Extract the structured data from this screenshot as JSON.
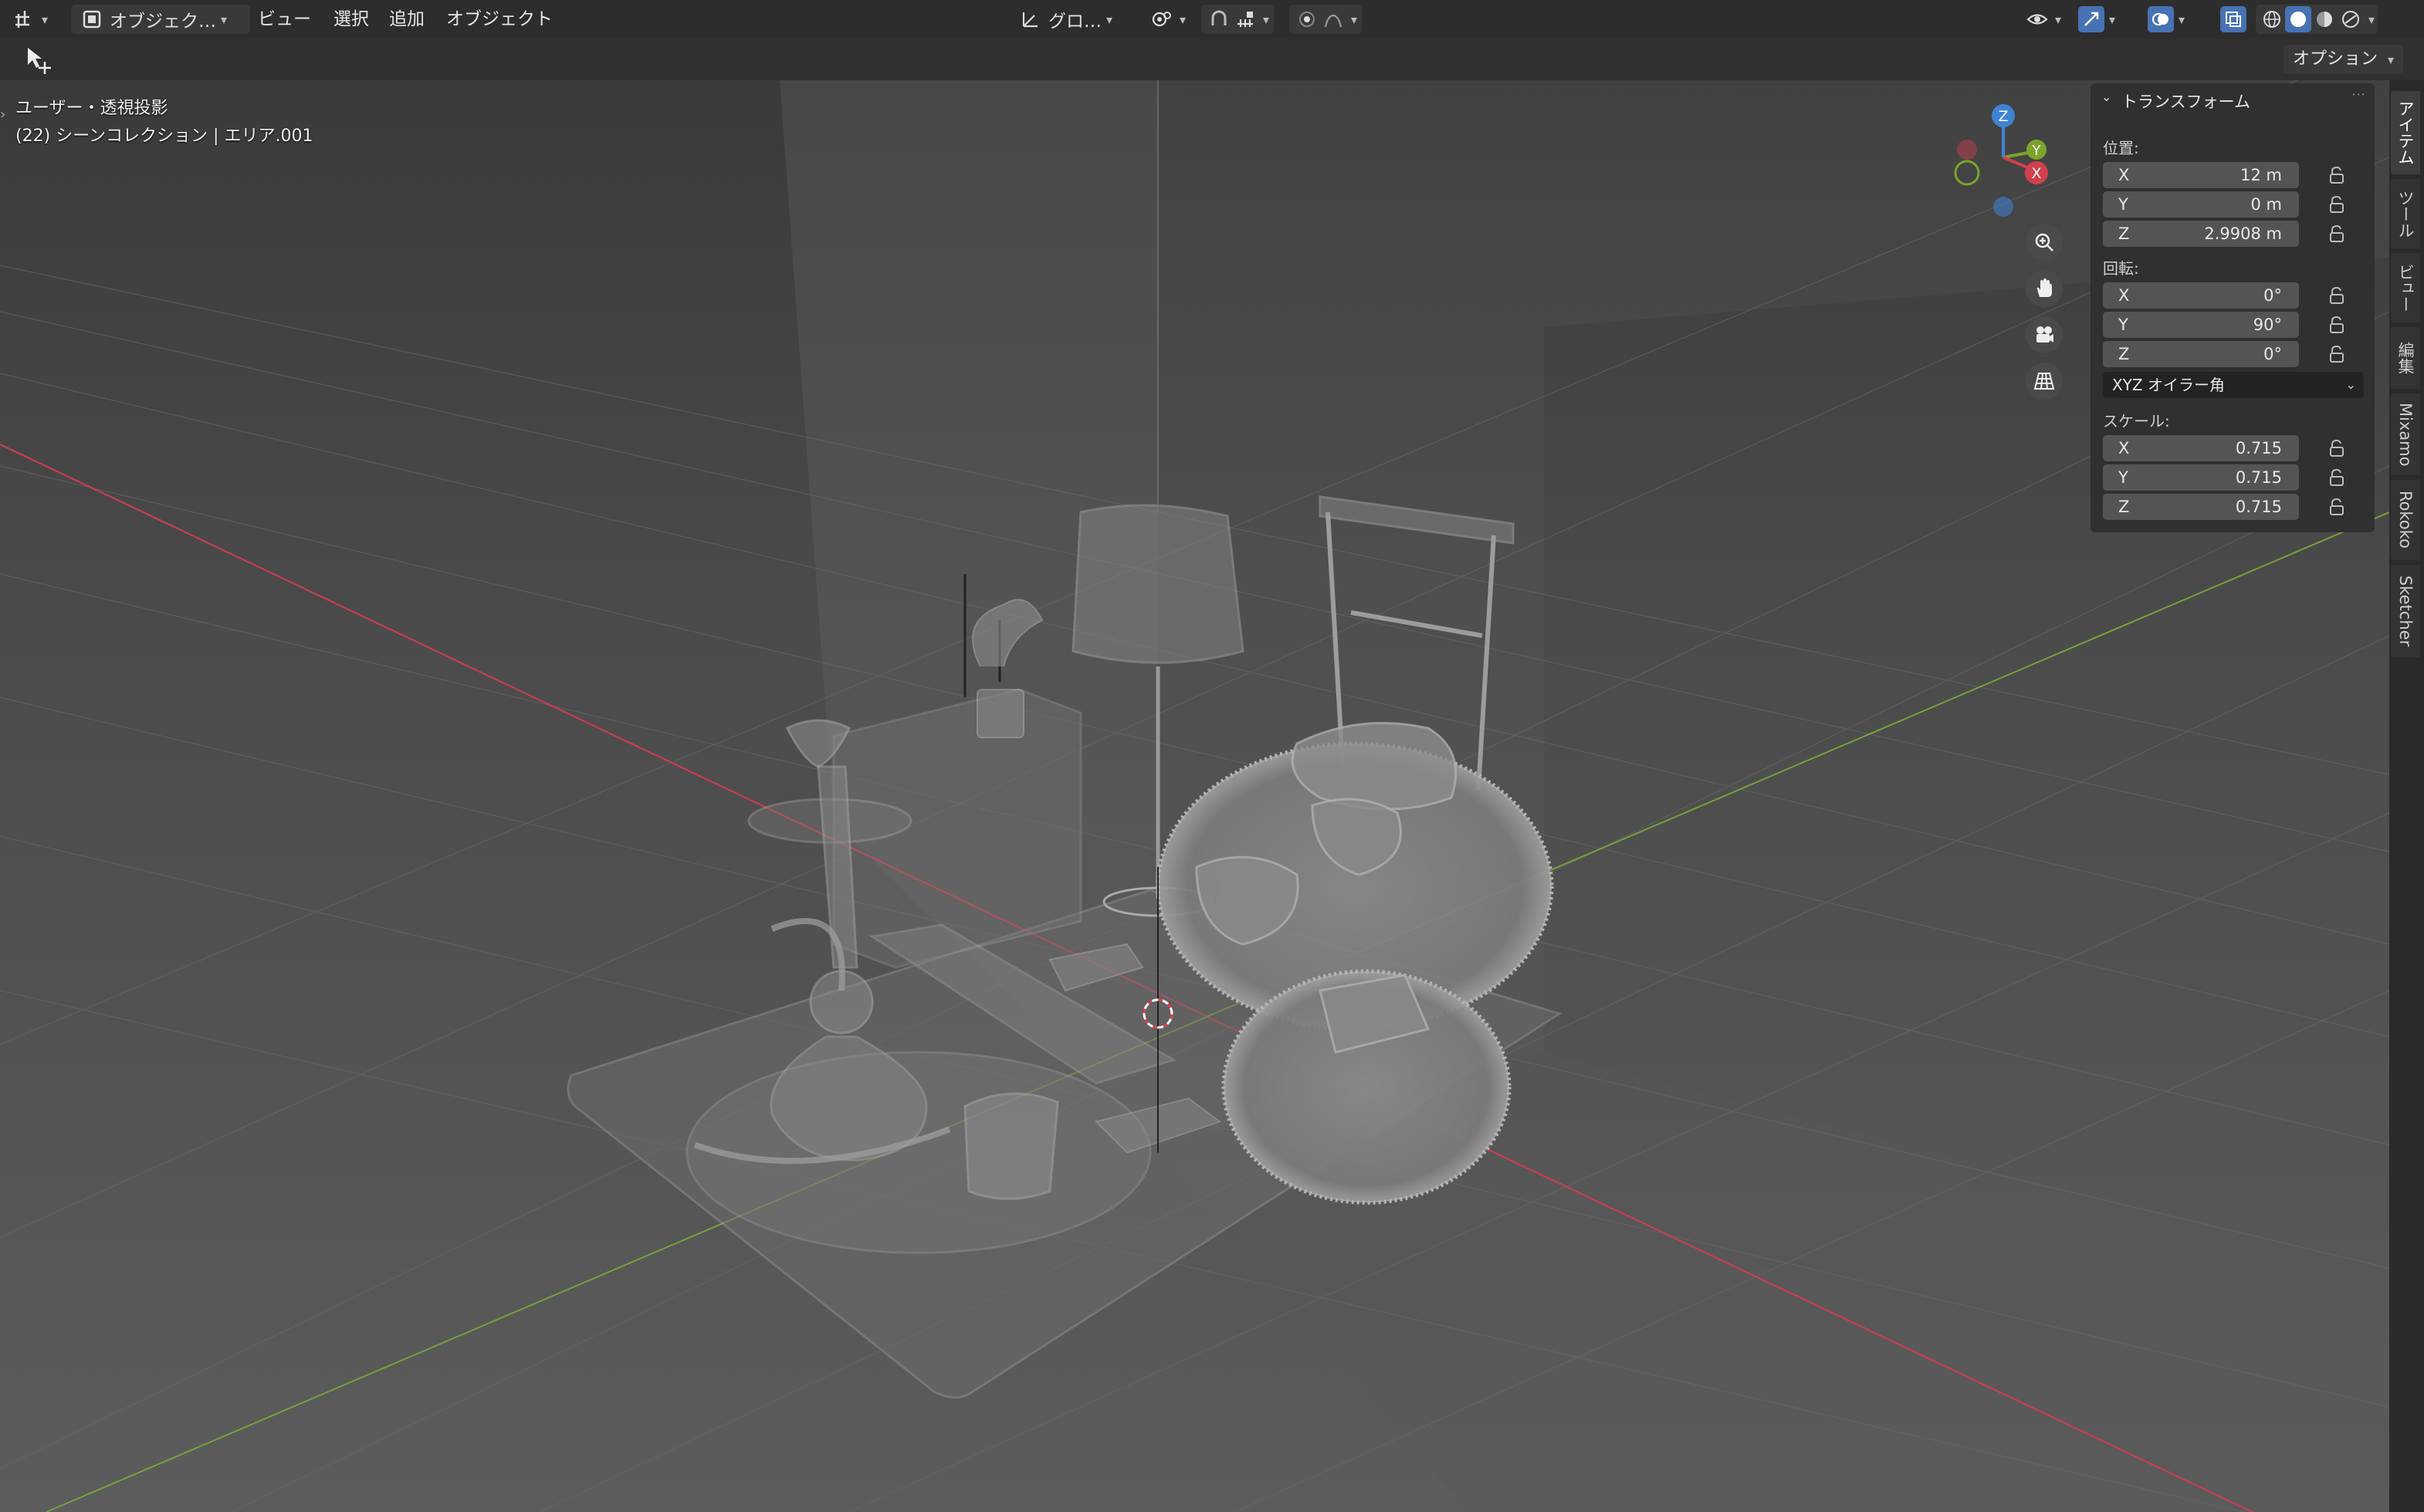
{
  "topbar": {
    "mode_label": "オブジェク…",
    "menu": [
      "ビュー",
      "選択",
      "追加",
      "オブジェクト"
    ],
    "transform_orientation": "グロ…",
    "options_label": "オプション"
  },
  "viewport": {
    "view_name": "ユーザー・透視投影",
    "collection_info": "(22) シーンコレクション | エリア.001",
    "gizmo": {
      "x": "X",
      "y": "Y",
      "z": "Z"
    }
  },
  "npanel": {
    "section_title": "トランスフォーム",
    "location_label": "位置:",
    "location": [
      {
        "axis": "X",
        "value": "12 m"
      },
      {
        "axis": "Y",
        "value": "0 m"
      },
      {
        "axis": "Z",
        "value": "2.9908 m"
      }
    ],
    "rotation_label": "回転:",
    "rotation": [
      {
        "axis": "X",
        "value": "0°"
      },
      {
        "axis": "Y",
        "value": "90°"
      },
      {
        "axis": "Z",
        "value": "0°"
      }
    ],
    "rotation_mode": "XYZ オイラー角",
    "scale_label": "スケール:",
    "scale": [
      {
        "axis": "X",
        "value": "0.715"
      },
      {
        "axis": "Y",
        "value": "0.715"
      },
      {
        "axis": "Z",
        "value": "0.715"
      }
    ]
  },
  "sidebar_tabs": [
    "アイテム",
    "ツール",
    "ビュー",
    "編集",
    "Mixamo",
    "Rokoko",
    "Sketcher"
  ],
  "colors": {
    "x_axis": "#d1404f",
    "y_axis": "#7ba52b",
    "z_axis": "#3f83d6",
    "accent": "#4772b3"
  }
}
